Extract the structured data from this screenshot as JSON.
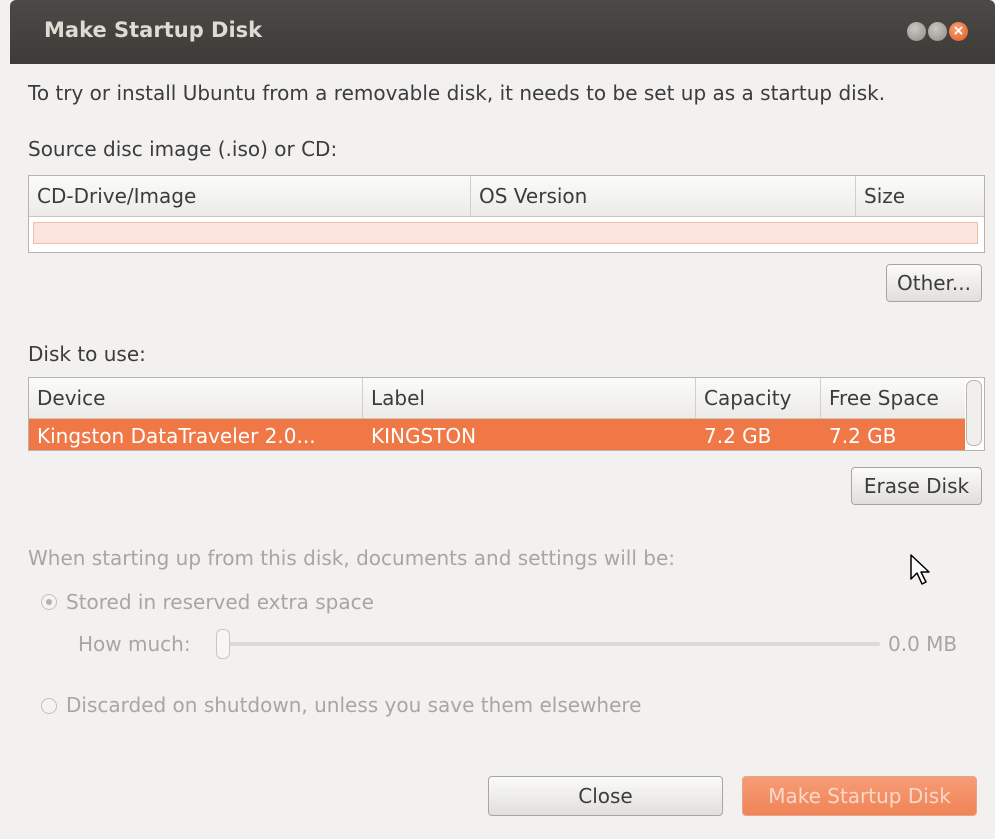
{
  "window": {
    "title": "Make Startup Disk",
    "close_glyph": "×"
  },
  "intro": "To try or install Ubuntu from a removable disk, it needs to be set up as a startup disk.",
  "source": {
    "label": "Source disc image (.iso) or CD:",
    "columns": [
      "CD-Drive/Image",
      "OS Version",
      "Size"
    ],
    "other_button": "Other..."
  },
  "disk": {
    "label": "Disk to use:",
    "columns": [
      "Device",
      "Label",
      "Capacity",
      "Free Space"
    ],
    "rows": [
      {
        "device": "Kingston DataTraveler 2.0...",
        "label": "KINGSTON",
        "capacity": "7.2 GB",
        "free": "7.2 GB"
      }
    ],
    "erase_button": "Erase Disk"
  },
  "persistence": {
    "heading": "When starting up from this disk, documents and settings will be:",
    "option_stored": "Stored in reserved extra space",
    "how_much_label": "How much:",
    "size_value": "0.0 MB",
    "slider_fraction": 0.0,
    "option_discarded": "Discarded on shutdown, unless you save them elsewhere"
  },
  "buttons": {
    "close": "Close",
    "make": "Make Startup Disk"
  },
  "colors": {
    "selection": "#f07746",
    "titlebar": "#3c3b37",
    "close_button": "#e0561f"
  }
}
